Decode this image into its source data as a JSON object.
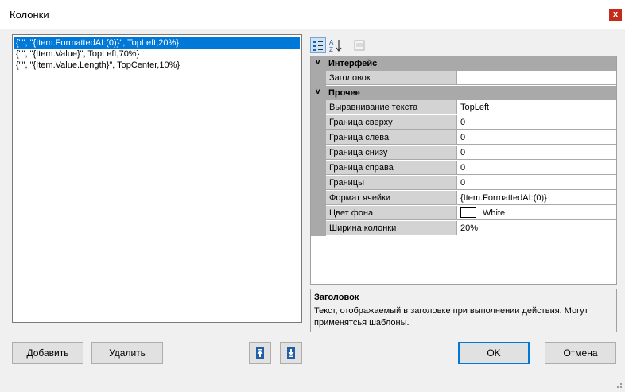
{
  "dialog": {
    "title": "Колонки",
    "close_glyph": "x"
  },
  "columns_list": [
    "{\"\", \"{Item.FormattedAI:(0)}\", TopLeft,20%}",
    "{\"\", \"{Item.Value}\", TopLeft,70%}",
    "{\"\", \"{Item.Value.Length}\", TopCenter,10%}"
  ],
  "selected_index": 0,
  "toolbar": {
    "icons": [
      "categorized-icon",
      "alphabetical-icon",
      "property-pages-icon"
    ],
    "alpha_glyph": "A",
    "alpha_glyph2": "Z"
  },
  "property_grid": {
    "categories": [
      {
        "name": "Интерфейс",
        "toggle": "v",
        "props": [
          {
            "name": "Заголовок",
            "value": ""
          }
        ]
      },
      {
        "name": "Прочее",
        "toggle": "v",
        "props": [
          {
            "name": "Выравнивание текста",
            "value": "TopLeft"
          },
          {
            "name": "Граница сверху",
            "value": "0"
          },
          {
            "name": "Граница слева",
            "value": "0"
          },
          {
            "name": "Граница снизу",
            "value": "0"
          },
          {
            "name": "Граница справа",
            "value": "0"
          },
          {
            "name": "Границы",
            "value": "0"
          },
          {
            "name": "Формат ячейки",
            "value": "{Item.FormattedAI:(0)}"
          },
          {
            "name": "Цвет фона",
            "value": "White",
            "swatch": "#ffffff"
          },
          {
            "name": "Ширина колонки",
            "value": "20%"
          }
        ]
      }
    ]
  },
  "description": {
    "title": "Заголовок",
    "text": "Текст, отображаемый в заголовке при выполнении действия. Могут применятсья шаблоны."
  },
  "buttons": {
    "add": "Добавить",
    "remove": "Удалить",
    "ok": "OK",
    "cancel": "Отмена"
  },
  "colors": {
    "selection": "#0078d7",
    "category_bg": "#a9a9a9",
    "name_bg": "#d3d3d3",
    "close_bg": "#c42b1c",
    "move_icon": "#1e5fa8"
  }
}
